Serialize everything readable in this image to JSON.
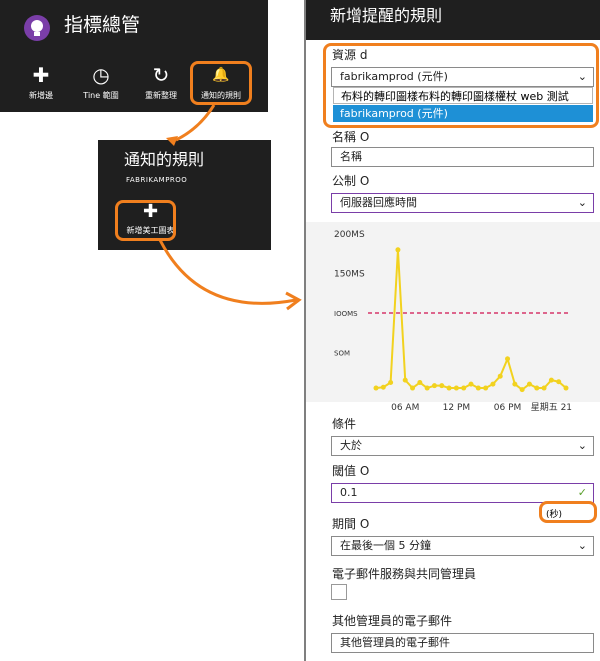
{
  "blade1": {
    "title": "指標總管",
    "commands": [
      {
        "label": "新增邊",
        "icon": "plus-icon",
        "glyph": "✚"
      },
      {
        "label": "Tine 範圍",
        "icon": "clock-icon",
        "glyph": "◷"
      },
      {
        "label": "重新整理",
        "icon": "refresh-icon",
        "glyph": "↻"
      },
      {
        "label": "通知的規則",
        "icon": "bell-icon",
        "glyph": "🔔"
      }
    ]
  },
  "blade2": {
    "title": "通知的規則",
    "subtitle": "FABRIKAMPROO",
    "add_label": "新增美工圖表",
    "add_glyph": "✚"
  },
  "panel": {
    "title": "新增提醒的規則",
    "resource_label": "資源 d",
    "resource_value": "fabrikamprod (元件)",
    "resource_options": [
      "布料的轉印圖樣布料的轉印圖樣權杖 web 測試",
      "fabrikamprod (元件)"
    ],
    "name_label": "名稱 O",
    "name_value": "名稱",
    "metric_label": "公制 O",
    "metric_value": "伺服器回應時間",
    "condition_label": "條件",
    "condition_value": "大於",
    "threshold_label": "閾值 O",
    "threshold_value": "0.1",
    "unit_label": "(秒)",
    "period_label": "期間 O",
    "period_value": "在最後一個 5 分鐘",
    "email_owners_label": "電子郵件服務與共同管理員",
    "other_email_label": "其他管理員的電子郵件",
    "other_email_value": "其他管理員的電子郵件",
    "checkmark": "✓",
    "chevron": "⌄"
  },
  "chart_data": {
    "type": "line",
    "series": [
      {
        "values": [
          5,
          6,
          12,
          180,
          15,
          5,
          12,
          5,
          8,
          8,
          5,
          5,
          5,
          10,
          5,
          5,
          10,
          20,
          42,
          10,
          3,
          10,
          5,
          5,
          15,
          13,
          5
        ]
      }
    ],
    "x": [
      0,
      1,
      2,
      3,
      4,
      5,
      6,
      7,
      8,
      9,
      10,
      11,
      12,
      13,
      14,
      15,
      16,
      17,
      18,
      19,
      20,
      21,
      22,
      23,
      24,
      25,
      26
    ],
    "x_tick_labels": [
      "06 AM",
      "12 PM",
      "06 PM",
      "星期五 21"
    ],
    "y_tick_labels": [
      "200MS",
      "150MS",
      "IOOMS",
      "SOM"
    ],
    "ylim": [
      0,
      200
    ],
    "threshold": 100,
    "colors": {
      "line": "#f2d21f",
      "threshold": "#d6366a"
    }
  }
}
